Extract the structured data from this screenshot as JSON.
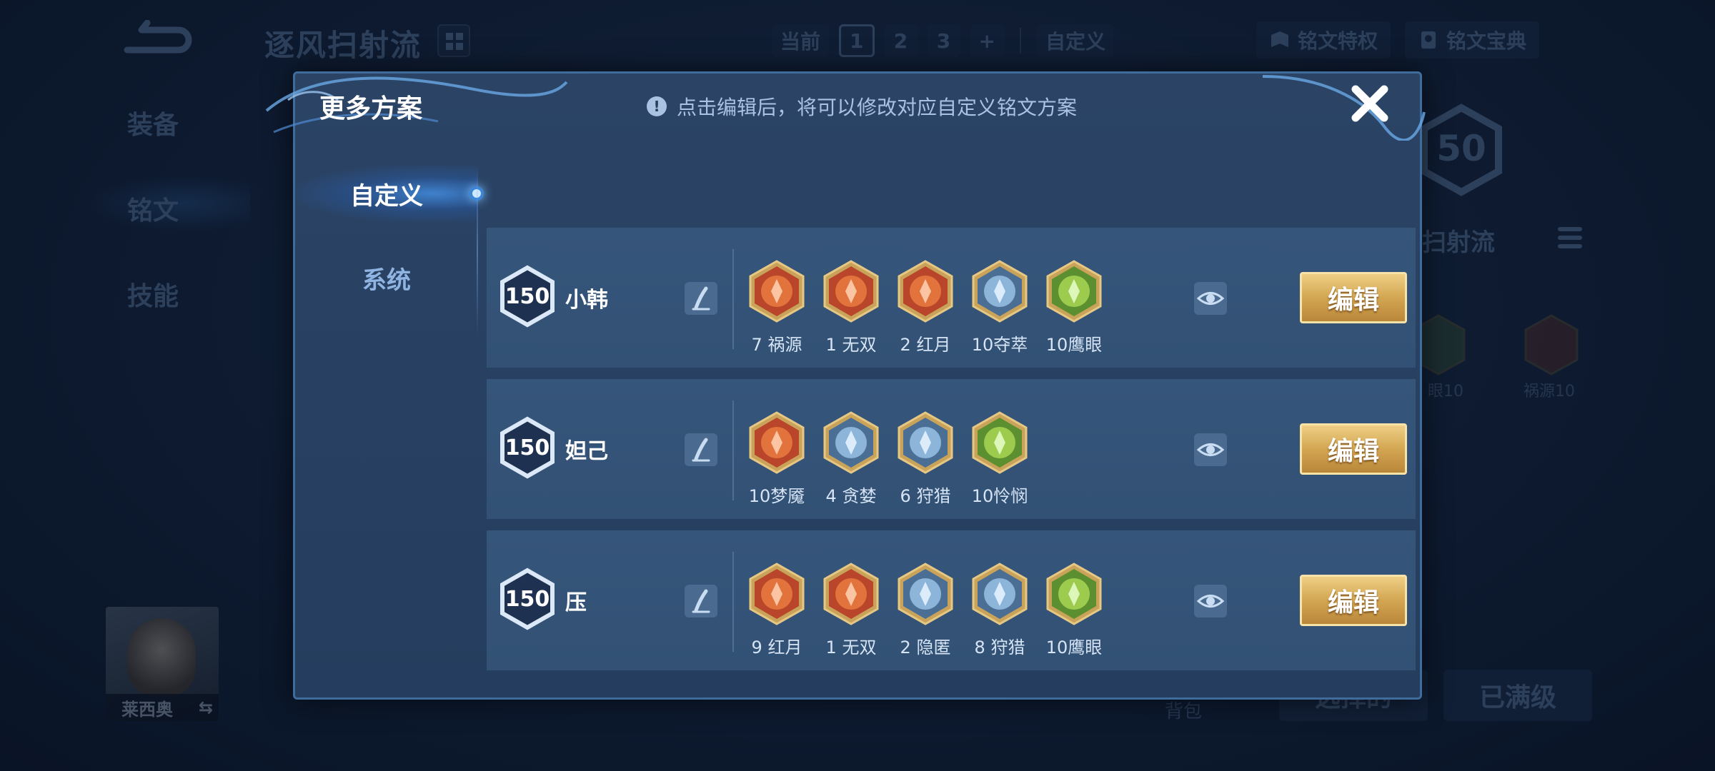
{
  "background": {
    "title": "逐风扫射流",
    "plan_bar": {
      "current_label": "当前",
      "plans": [
        "1",
        "2",
        "3"
      ],
      "add": "+",
      "custom": "自定义"
    },
    "privilege_label": "铭文特权",
    "codex_label": "铭文宝典",
    "side_menu": [
      "装备",
      "铭文",
      "技能"
    ],
    "hero_name": "莱西奥",
    "swap_glyph": "⇆",
    "level_badge": "50",
    "right_name": "扫射流",
    "rune_labels": [
      "眼10",
      "祸源10"
    ],
    "backpack_label": "背包",
    "select_btn": "选择的",
    "maxed_btn": "已满级"
  },
  "modal": {
    "title": "更多方案",
    "hint": "点击编辑后，将可以修改对应自定义铭文方案",
    "hint_icon": "!",
    "tabs": [
      {
        "label": "自定义",
        "active": true
      },
      {
        "label": "系统",
        "active": false
      }
    ],
    "rows": [
      {
        "level": "150",
        "name": "小韩",
        "runes": [
          {
            "label": "7 祸源",
            "color": "red"
          },
          {
            "label": "1 无双",
            "color": "red"
          },
          {
            "label": "2 红月",
            "color": "red"
          },
          {
            "label": "10夺萃",
            "color": "blue"
          },
          {
            "label": "10鹰眼",
            "color": "green"
          }
        ],
        "edit_label": "编辑"
      },
      {
        "level": "150",
        "name": "妲己",
        "runes": [
          {
            "label": "10梦魇",
            "color": "red"
          },
          {
            "label": "4 贪婪",
            "color": "blue"
          },
          {
            "label": "6 狩猎",
            "color": "blue"
          },
          {
            "label": "10怜悯",
            "color": "green"
          }
        ],
        "edit_label": "编辑"
      },
      {
        "level": "150",
        "name": "压",
        "runes": [
          {
            "label": "9 红月",
            "color": "red"
          },
          {
            "label": "1 无双",
            "color": "red"
          },
          {
            "label": "2 隐匿",
            "color": "blue"
          },
          {
            "label": "8 狩猎",
            "color": "blue"
          },
          {
            "label": "10鹰眼",
            "color": "green"
          }
        ],
        "edit_label": "编辑"
      }
    ]
  },
  "colors": {
    "rune_red": "#d5582a",
    "rune_blue": "#6a9cc8",
    "rune_green": "#7cb342",
    "gold_border": "#d9b46a",
    "edit_button": "#d3a652"
  }
}
